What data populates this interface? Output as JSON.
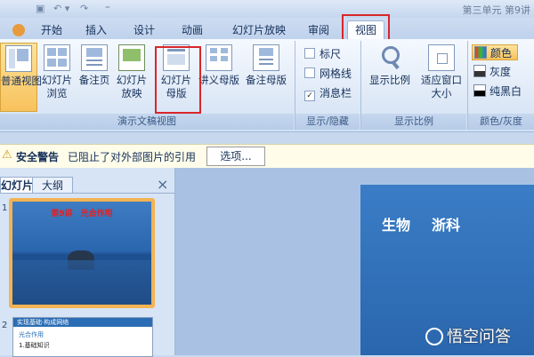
{
  "title": "第三单元 第9讲",
  "tabs": [
    "开始",
    "插入",
    "设计",
    "动画",
    "幻灯片放映",
    "审阅",
    "视图"
  ],
  "active_tab": "视图",
  "ribbon": {
    "groups": {
      "presentation_views": {
        "label": "演示文稿视图",
        "buttons": [
          "普通视图",
          "幻灯片浏览",
          "备注页",
          "幻灯片放映",
          "幻灯片母版",
          "讲义母版",
          "备注母版"
        ]
      },
      "show_hide": {
        "label": "显示/隐藏",
        "checkboxes": [
          {
            "label": "标尺",
            "checked": false
          },
          {
            "label": "网格线",
            "checked": false
          },
          {
            "label": "消息栏",
            "checked": true
          }
        ]
      },
      "zoom": {
        "label": "显示比例",
        "buttons": [
          "显示比例",
          "适应窗口大小"
        ]
      },
      "color": {
        "label": "颜色/灰度",
        "items": [
          "颜色",
          "灰度",
          "纯黑白"
        ]
      }
    }
  },
  "security_bar": {
    "title": "安全警告",
    "message": "已阻止了对外部图片的引用",
    "button": "选项..."
  },
  "left_pane": {
    "tabs": [
      "幻灯片",
      "大纲"
    ],
    "close": "×",
    "slide1": {
      "number": "1",
      "title": "第9讲　光合作用"
    },
    "slide2": {
      "number": "2",
      "header": "实现基础·构成网络",
      "line1": "光合作用",
      "line2": "1.基础知识"
    }
  },
  "slide": {
    "text1": "生物",
    "text2": "浙科"
  },
  "watermark": "悟空问答"
}
